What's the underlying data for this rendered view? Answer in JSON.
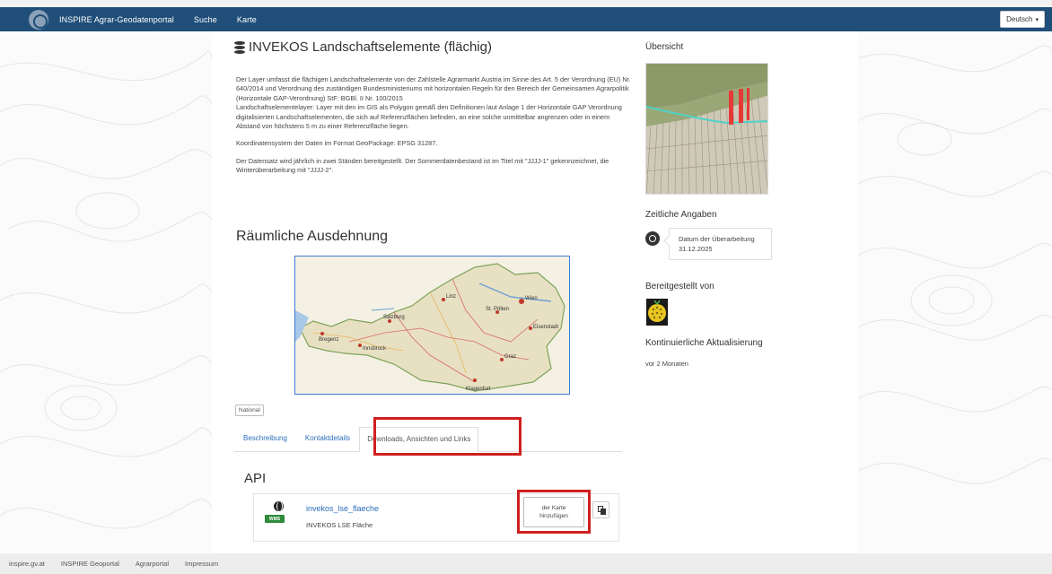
{
  "navbar": {
    "brand": "INSPIRE Agrar-Geodatenportal",
    "links": [
      "Suche",
      "Karte"
    ],
    "language": "Deutsch"
  },
  "main": {
    "title": "INVEKOS Landschaftselemente (flächig)",
    "description": [
      "Der Layer umfasst die flächigen Landschaftselemente von der Zahlstelle Agrarmarkt Austria im Sinne des Art. 5 der Verordnung (EU) Nr. 640/2014 und Verordnung des zuständigen Bundesministeriums mit horizontalen Regeln für den Bereich der Gemeinsamen Agrarpolitik (Horizontale GAP-Verordnung) StF: BGBl. II Nr. 100/2015",
      "Landschaftselementelayer: Layer mit den im GIS als Polygon gemäß den Definitionen laut Anlage 1 der Horizontale GAP Verordnung digitalisierten Landschaftselementen, die sich auf Referenzflächen befinden, an eine solche unmittelbar angrenzen oder in einem Abstand von höchstens 5 m zu einer Referenzfläche liegen.",
      "Koordinatensystem der Daten im Format GeoPackage: EPSG 31287.",
      "Der Datensatz wird jährlich in zwei Ständen bereitgestellt. Der Sommerdatenbestand ist im Titel mit \"JJJJ-1\" gekennzeichnet, die Winterüberarbeitung mit \"JJJJ-2\"."
    ],
    "extent_heading": "Räumliche Ausdehnung",
    "map_labels": [
      "Salzburg",
      "Innsbruck",
      "Bregenz",
      "Linz",
      "Wien",
      "Graz",
      "Klagenfurt",
      "St. Pölten",
      "Eisenstadt"
    ],
    "extent_badge": "National",
    "tabs": [
      "Beschreibung",
      "Kontaktdetails",
      "Downloads, Ansichten und Links"
    ],
    "active_tab": 2,
    "api_heading": "API",
    "api_item": {
      "link": "invekos_lse_flaeche",
      "subtitle": "INVEKOS LSE Fläche",
      "badge": "WMS",
      "add_button": "der Karte hinzufügen"
    }
  },
  "sidebar": {
    "overview_heading": "Übersicht",
    "temporal_heading": "Zeitliche Angaben",
    "temporal_label": "Datum der Überarbeitung",
    "temporal_date": "31.12.2025",
    "provided_heading": "Bereitgestellt von",
    "update_heading": "Kontinuierliche Aktualisierung",
    "update_text": "vor 2 Monaten"
  },
  "footer": {
    "links": [
      "inspire.gv.at",
      "INSPIRE Geoportal",
      "Agrarportal",
      "Impressum"
    ]
  },
  "colors": {
    "navbar": "#1f4e79",
    "link": "#2a6ebb",
    "highlight": "#d01f1f",
    "wms_badge": "#2e8b3c"
  }
}
